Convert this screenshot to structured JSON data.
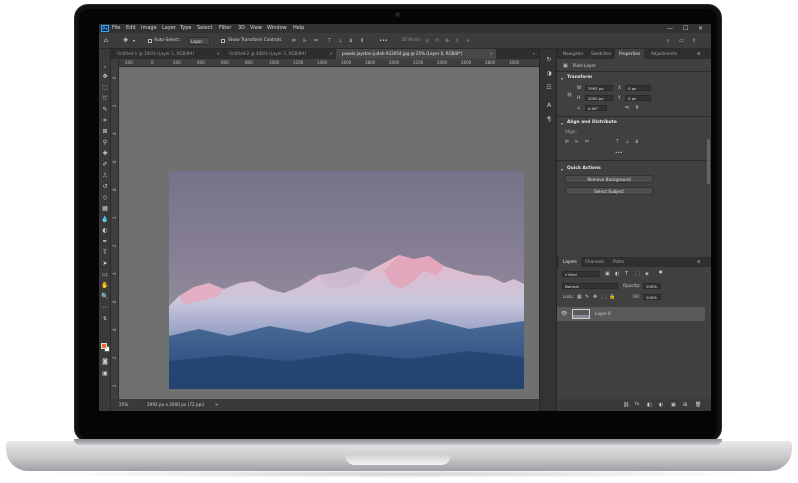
{
  "menubar": {
    "app_icon": "Ps",
    "items": [
      "File",
      "Edit",
      "Image",
      "Layer",
      "Type",
      "Select",
      "Filter",
      "3D",
      "View",
      "Window",
      "Help"
    ],
    "window_controls": [
      "—",
      "☐",
      "✕"
    ]
  },
  "options_bar": {
    "auto_select_label": "Auto-Select:",
    "auto_select_target": "Layer",
    "show_transform_label": "Show Transform Controls",
    "mode_3d_label": "3D Mode:"
  },
  "document_tabs": [
    {
      "label": "Untitled-1 @ 100% (Layer 1, RGB/8#)",
      "active": false
    },
    {
      "label": "Untitled-2 @ 400% (Layer 3, RGB/8#)",
      "active": false
    },
    {
      "label": "pexels-joyston-judah-933054.jpg @ 25% (Layer 0, RGB/8*)",
      "active": true
    }
  ],
  "ruler": {
    "top_ticks": [
      "200",
      "0",
      "200",
      "400",
      "600",
      "800",
      "1000",
      "1200",
      "1400",
      "1600",
      "1800",
      "2000",
      "2200",
      "2400",
      "2600",
      "2800",
      "3000"
    ],
    "left_ticks": [
      "0",
      "2",
      "4",
      "6",
      "8",
      "1",
      "2",
      "4",
      "6",
      "8",
      "2",
      "2"
    ]
  },
  "status_bar": {
    "zoom": "25%",
    "doc_info": "2992 px x 2000 px (72 ppi)",
    "arrow": ">"
  },
  "right_panel": {
    "top_tabs": [
      "Navigator",
      "Swatches",
      "Properties",
      "Adjustments"
    ],
    "active_top_tab": "Properties",
    "pixel_layer_label": "Pixel Layer",
    "transform_header": "Transform",
    "w_label": "W",
    "w_value": "2992 px",
    "h_label": "H",
    "h_value": "2000 px",
    "x_label": "X",
    "x_value": "0 px",
    "y_label": "Y",
    "y_value": "0 px",
    "angle_value": "0.00°",
    "align_header": "Align and Distribute",
    "align_sub": "Align:",
    "more": "•••",
    "quick_actions_header": "Quick Actions",
    "remove_bg_button": "Remove Background",
    "select_subject_button": "Select Subject",
    "layers_tabs": [
      "Layers",
      "Channels",
      "Paths"
    ],
    "active_layers_tab": "Layers",
    "kind_label": "Kind",
    "blend_mode": "Normal",
    "opacity_label": "Opacity:",
    "opacity_value": "100%",
    "lock_label": "Lock:",
    "fill_label": "Fill:",
    "fill_value": "100%",
    "layer_name": "Layer 0",
    "bottom_icons": [
      "fx",
      "◧",
      "◐",
      "▣",
      "⊞",
      "🗑"
    ]
  },
  "colors": {
    "foreground": "#e36b2d",
    "background": "#ffffff",
    "accent": "#31a8ff"
  }
}
